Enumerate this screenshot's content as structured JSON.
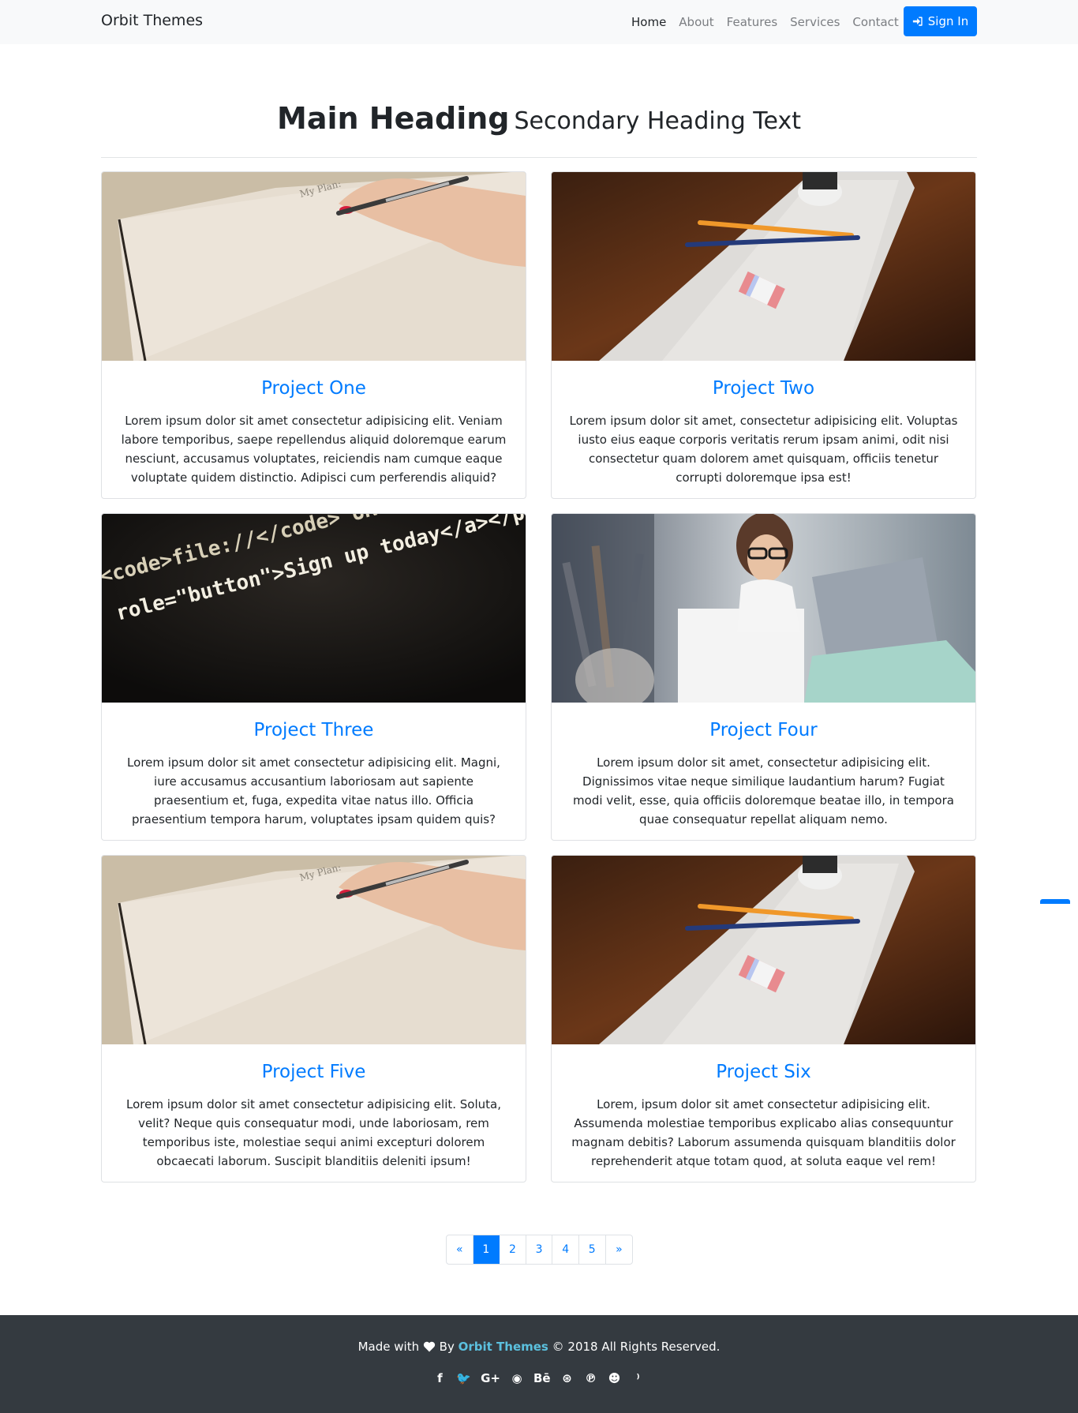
{
  "navbar": {
    "brand": "Orbit Themes",
    "links": [
      {
        "label": "Home",
        "active": true
      },
      {
        "label": "About",
        "active": false
      },
      {
        "label": "Features",
        "active": false
      },
      {
        "label": "Services",
        "active": false
      },
      {
        "label": "Contact",
        "active": false
      }
    ],
    "signin_label": "Sign In",
    "signin_icon": "sign-in-icon"
  },
  "heading": {
    "main": "Main Heading",
    "secondary": "Secondary Heading Text"
  },
  "cards": [
    {
      "title": "Project One",
      "image": "notebook-hand-pen",
      "text": "Lorem ipsum dolor sit amet consectetur adipisicing elit. Veniam labore temporibus, saepe repellendus aliquid doloremque earum nesciunt, accusamus voluptates, reiciendis nam cumque eaque voluptate quidem distinctio. Adipisci cum perferendis aliquid?"
    },
    {
      "title": "Project Two",
      "image": "paper-pencils-desk",
      "text": "Lorem ipsum dolor sit amet, consectetur adipisicing elit. Voluptas iusto eius eaque corporis veritatis rerum ipsam animi, odit nisi consectetur quam dolorem amet quisquam, officiis tenetur corrupti doloremque ipsa est!"
    },
    {
      "title": "Project Three",
      "image": "code-screen",
      "text": "Lorem ipsum dolor sit amet consectetur adipisicing elit. Magni, iure accusamus accusantium laboriosam aut sapiente praesentium et, fuga, expedita vitae natus illo. Officia praesentium tempora harum, voluptates ipsam quidem quis?"
    },
    {
      "title": "Project Four",
      "image": "woman-laptop",
      "text": "Lorem ipsum dolor sit amet, consectetur adipisicing elit. Dignissimos vitae neque similique laudantium harum? Fugiat modi velit, esse, quia officiis doloremque beatae illo, in tempora quae consequatur repellat aliquam nemo."
    },
    {
      "title": "Project Five",
      "image": "notebook-hand-pen",
      "text": "Lorem ipsum dolor sit amet consectetur adipisicing elit. Soluta, velit? Neque quis consequatur modi, unde laboriosam, rem temporibus iste, molestiae sequi animi excepturi dolorem obcaecati laborum. Suscipit blanditiis deleniti ipsum!"
    },
    {
      "title": "Project Six",
      "image": "paper-pencils-desk",
      "text": "Lorem, ipsum dolor sit amet consectetur adipisicing elit. Assumenda molestiae temporibus explicabo alias consequuntur magnam debitis? Laborum assumenda quisquam blanditiis dolor reprehenderit atque totam quod, at soluta eaque vel rem!"
    }
  ],
  "image_text": {
    "notebook": "My Plan:",
    "code_line1": "<code>file://</code> URL, a",
    "code_line2": "\" role=\"button\">Sign up today</a></p>"
  },
  "pagination": {
    "prev": "«",
    "pages": [
      "1",
      "2",
      "3",
      "4",
      "5"
    ],
    "active": "1",
    "next": "»"
  },
  "footer": {
    "made_with": "Made with",
    "by": "By",
    "brand": "Orbit Themes",
    "rights": "© 2018 All Rights Reserved.",
    "social_icons": [
      {
        "name": "facebook-icon",
        "glyph": "f"
      },
      {
        "name": "twitter-icon",
        "glyph": "🐦"
      },
      {
        "name": "google-plus-icon",
        "glyph": "G+"
      },
      {
        "name": "github-icon",
        "glyph": "◉"
      },
      {
        "name": "behance-icon",
        "glyph": "Bē"
      },
      {
        "name": "dribbble-icon",
        "glyph": "⊛"
      },
      {
        "name": "pinterest-icon",
        "glyph": "℗"
      },
      {
        "name": "reddit-icon",
        "glyph": "☻"
      },
      {
        "name": "rss-icon",
        "glyph": "⁾"
      }
    ]
  },
  "colors": {
    "primary": "#007bff",
    "navbar_bg": "#f8f9fa",
    "footer_bg": "#343a40",
    "footer_brand": "#5bc0de"
  }
}
